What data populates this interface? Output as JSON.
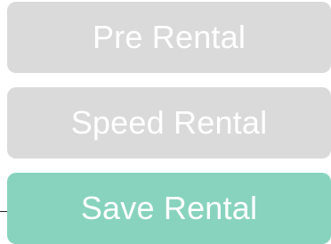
{
  "actions": {
    "pre_rental_label": "Pre Rental",
    "speed_rental_label": "Speed Rental",
    "save_rental_label": "Save Rental"
  },
  "colors": {
    "disabled_button": "#dadada",
    "primary_button": "#88d3bd",
    "button_text": "#ffffff"
  }
}
